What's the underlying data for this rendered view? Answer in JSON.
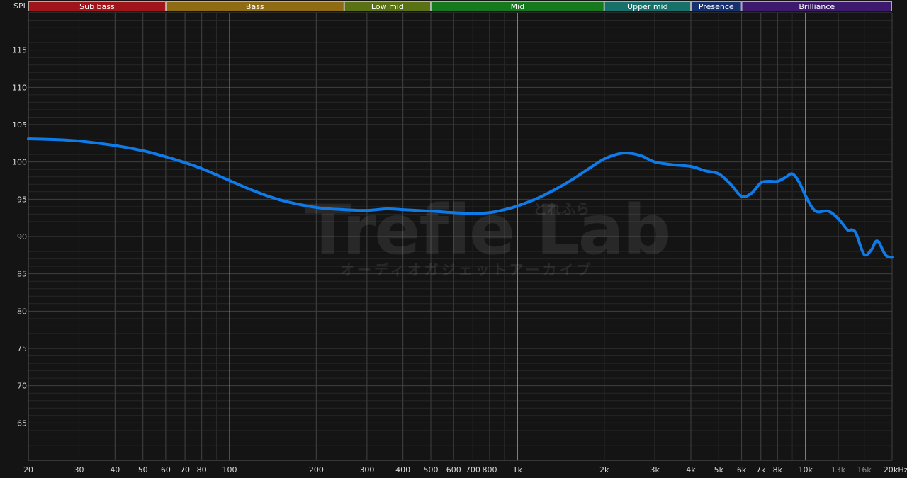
{
  "chart_data": {
    "type": "line",
    "xscale": "log",
    "xlim": [
      20,
      20000
    ],
    "ylim": [
      60,
      120
    ],
    "ylabel": "SPL",
    "xunit": "kHz",
    "grid": true,
    "bands": [
      {
        "name": "Sub bass",
        "from": 20,
        "to": 60,
        "color": "#a01519"
      },
      {
        "name": "Bass",
        "from": 60,
        "to": 250,
        "color": "#8f6b13"
      },
      {
        "name": "Low mid",
        "from": 250,
        "to": 500,
        "color": "#5a7214"
      },
      {
        "name": "Mid",
        "from": 500,
        "to": 2000,
        "color": "#17791d"
      },
      {
        "name": "Upper mid",
        "from": 2000,
        "to": 4000,
        "color": "#17706a"
      },
      {
        "name": "Presence",
        "from": 4000,
        "to": 6000,
        "color": "#17306e"
      },
      {
        "name": "Brilliance",
        "from": 6000,
        "to": 20000,
        "color": "#3d1a6e"
      }
    ],
    "y_ticks": [
      65,
      70,
      75,
      80,
      85,
      90,
      95,
      100,
      105,
      110,
      115
    ],
    "x_ticks": [
      {
        "value": 20,
        "label": "20"
      },
      {
        "value": 30,
        "label": "30"
      },
      {
        "value": 40,
        "label": "40"
      },
      {
        "value": 50,
        "label": "50"
      },
      {
        "value": 60,
        "label": "60"
      },
      {
        "value": 70,
        "label": "70"
      },
      {
        "value": 80,
        "label": "80"
      },
      {
        "value": 100,
        "label": "100"
      },
      {
        "value": 200,
        "label": "200"
      },
      {
        "value": 300,
        "label": "300"
      },
      {
        "value": 400,
        "label": "400"
      },
      {
        "value": 500,
        "label": "500"
      },
      {
        "value": 600,
        "label": "600"
      },
      {
        "value": 700,
        "label": "700"
      },
      {
        "value": 800,
        "label": "800"
      },
      {
        "value": 1000,
        "label": "1k"
      },
      {
        "value": 2000,
        "label": "2k"
      },
      {
        "value": 3000,
        "label": "3k"
      },
      {
        "value": 4000,
        "label": "4k"
      },
      {
        "value": 5000,
        "label": "5k"
      },
      {
        "value": 6000,
        "label": "6k"
      },
      {
        "value": 7000,
        "label": "7k"
      },
      {
        "value": 8000,
        "label": "8k"
      },
      {
        "value": 10000,
        "label": "10k"
      },
      {
        "value": 13000,
        "label": "13k",
        "dim": true
      },
      {
        "value": 16000,
        "label": "16k",
        "dim": true
      },
      {
        "value": 20000,
        "label": "20k"
      }
    ],
    "series": [
      {
        "color": "#0f7be8",
        "x": [
          20,
          25,
          30,
          40,
          50,
          60,
          70,
          80,
          100,
          120,
          150,
          200,
          250,
          300,
          350,
          400,
          500,
          600,
          700,
          800,
          900,
          1000,
          1200,
          1500,
          1800,
          2000,
          2200,
          2400,
          2700,
          3000,
          3500,
          4000,
          4500,
          5000,
          5500,
          6000,
          6500,
          7000,
          7500,
          8000,
          8500,
          9000,
          9500,
          10000,
          10500,
          11000,
          12000,
          13000,
          14000,
          14500,
          15000,
          16000,
          17000,
          17500,
          18000,
          19000,
          20000
        ],
        "y": [
          103.1,
          103.0,
          102.8,
          102.2,
          101.5,
          100.7,
          99.9,
          99.1,
          97.5,
          96.2,
          94.9,
          93.9,
          93.6,
          93.5,
          93.7,
          93.6,
          93.4,
          93.2,
          93.1,
          93.2,
          93.6,
          94.1,
          95.3,
          97.3,
          99.3,
          100.4,
          101.0,
          101.2,
          100.8,
          100.0,
          99.6,
          99.4,
          98.8,
          98.4,
          97.0,
          95.4,
          95.8,
          97.2,
          97.4,
          97.4,
          97.9,
          98.4,
          97.3,
          95.5,
          94.0,
          93.3,
          93.4,
          92.4,
          90.9,
          90.9,
          90.4,
          87.6,
          88.3,
          89.3,
          89.2,
          87.5,
          87.2
        ]
      }
    ]
  },
  "watermark": {
    "main": "Trefle Lab",
    "sub": "オーディオガジェットアーカイブ",
    "small": "とれふら"
  }
}
